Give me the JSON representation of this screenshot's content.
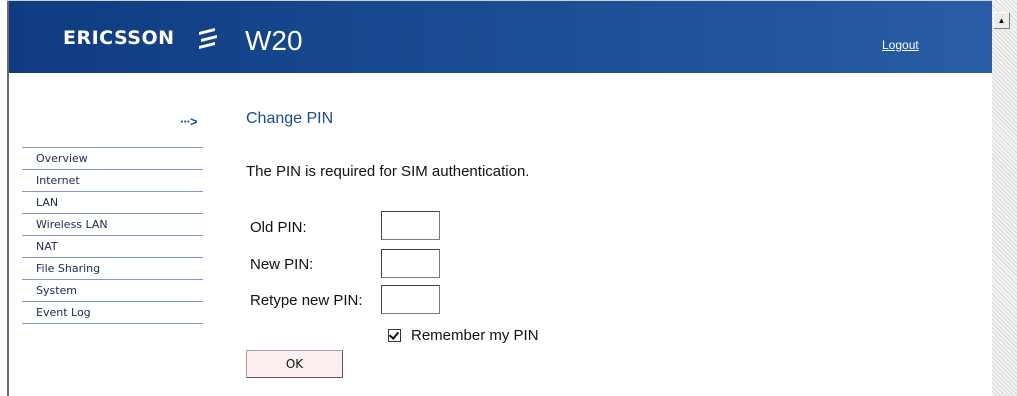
{
  "header": {
    "brand": "ERICSSON",
    "brand_icon": "ericsson-logo-icon",
    "product": "W20",
    "logout_label": "Logout",
    "colors": {
      "header_start": "#0f3b80",
      "header_end": "#2a5da5"
    }
  },
  "nav": {
    "arrow": "···>",
    "items": [
      {
        "label": "Overview"
      },
      {
        "label": "Internet"
      },
      {
        "label": "LAN"
      },
      {
        "label": "Wireless LAN"
      },
      {
        "label": "NAT"
      },
      {
        "label": "File Sharing"
      },
      {
        "label": "System"
      },
      {
        "label": "Event Log"
      }
    ]
  },
  "main": {
    "title": "Change PIN",
    "description": "The PIN is required for SIM authentication.",
    "fields": [
      {
        "label": "Old PIN:",
        "value": ""
      },
      {
        "label": "New PIN:",
        "value": ""
      },
      {
        "label": "Retype new PIN:",
        "value": ""
      }
    ],
    "remember_label": "Remember my PIN",
    "remember_checked": true,
    "ok_label": "OK"
  },
  "scrollbar": {
    "up_icon": "scroll-up-arrow-icon"
  }
}
